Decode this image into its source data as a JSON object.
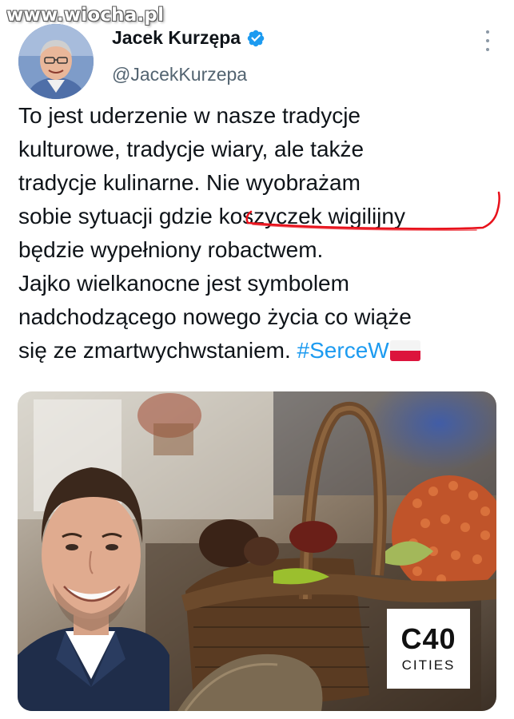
{
  "watermark": "www.wiocha.pl",
  "author": {
    "name": "Jacek Kurzępa",
    "handle": "@JacekKurzepa"
  },
  "tweet": {
    "lines": [
      "To jest uderzenie w nasze tradycje",
      "kulturowe, tradycje wiary, ale także",
      "tradycje kulinarne. Nie wyobrażam"
    ],
    "line4_before": "sobie sytuacji gdzie ",
    "line4_highlight": "koszyczek wigilijny",
    "line5": "będzie wypełniony robactwem.",
    "line6": "Jajko wielkanocne jest symbolem",
    "line7": "nadchodzącego nowego życia co wiąże",
    "line8_text": "się ze zmartwychwstaniem. ",
    "hashtag": "#SerceW"
  },
  "media": {
    "badge_big": "C40",
    "badge_small": "CITIES"
  },
  "colors": {
    "hashtag": "#1d9bf0",
    "verified": "#1d9bf0",
    "handle": "#536471",
    "annotation": "#e8111b"
  },
  "icons": [
    "verified-badge-icon",
    "more-options-icon",
    "poland-flag-icon"
  ]
}
